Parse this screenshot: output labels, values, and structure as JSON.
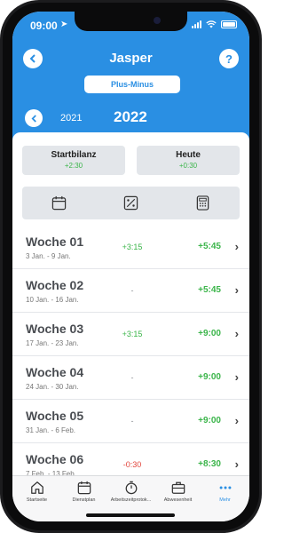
{
  "status": {
    "time": "09:00",
    "location_icon": "location-arrow-icon"
  },
  "header": {
    "title": "Jasper",
    "back_icon": "chevron-left-icon",
    "help_label": "?",
    "segment_label": "Plus-Minus",
    "year_prev_icon": "chevron-left-icon",
    "year_previous": "2021",
    "year_current": "2022"
  },
  "balances": {
    "start": {
      "label": "Startbilanz",
      "value": "+2:30"
    },
    "today": {
      "label": "Heute",
      "value": "+0:30"
    }
  },
  "icon_bar": [
    "calendar-icon",
    "percent-tag-icon",
    "calculator-icon"
  ],
  "weeks": [
    {
      "name": "Woche 01",
      "range": "3 Jan. - 9 Jan.",
      "diff": "+3:15",
      "diff_type": "green",
      "total": "+5:45"
    },
    {
      "name": "Woche 02",
      "range": "10 Jan. - 16 Jan.",
      "diff": "-",
      "diff_type": "gray",
      "total": "+5:45"
    },
    {
      "name": "Woche 03",
      "range": "17 Jan. - 23 Jan.",
      "diff": "+3:15",
      "diff_type": "green",
      "total": "+9:00"
    },
    {
      "name": "Woche 04",
      "range": "24 Jan. - 30 Jan.",
      "diff": "-",
      "diff_type": "gray",
      "total": "+9:00"
    },
    {
      "name": "Woche 05",
      "range": "31 Jan. - 6 Feb.",
      "diff": "-",
      "diff_type": "gray",
      "total": "+9:00"
    },
    {
      "name": "Woche 06",
      "range": "7 Feb. - 13 Feb.",
      "diff": "-0:30",
      "diff_type": "red",
      "total": "+8:30"
    }
  ],
  "tabs": [
    {
      "label": "Startseite",
      "icon": "home-icon"
    },
    {
      "label": "Dienstplan",
      "icon": "calendar-icon"
    },
    {
      "label": "Arbeitszeitprotok...",
      "icon": "stopwatch-icon"
    },
    {
      "label": "Abwesenheit",
      "icon": "briefcase-icon"
    },
    {
      "label": "Mehr",
      "icon": "more-dots-icon",
      "active": true
    }
  ],
  "colors": {
    "primary": "#2a8fe3",
    "positive": "#3bb54a",
    "negative": "#e2453c"
  }
}
